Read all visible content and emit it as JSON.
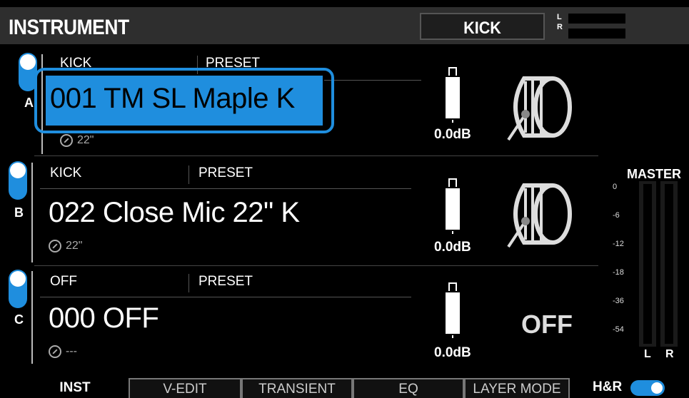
{
  "header": {
    "title": "INSTRUMENT",
    "instrument": "KICK",
    "meter_left_label": "L",
    "meter_right_label": "R"
  },
  "layers": [
    {
      "letter": "A",
      "enabled": true,
      "category": "KICK",
      "preset_label": "PRESET",
      "name": "001 TM SL Maple K",
      "size": "22\"",
      "level": "0.0dB",
      "selected": true
    },
    {
      "letter": "B",
      "enabled": true,
      "category": "KICK",
      "preset_label": "PRESET",
      "name": "022 Close Mic 22\" K",
      "size": "22\"",
      "level": "0.0dB",
      "selected": false
    },
    {
      "letter": "C",
      "enabled": true,
      "category": "OFF",
      "preset_label": "PRESET",
      "name": "000 OFF",
      "size": "---",
      "level": "0.0dB",
      "status": "OFF",
      "selected": false
    }
  ],
  "master": {
    "title": "MASTER",
    "scale": [
      "0",
      "-6",
      "-12",
      "-18",
      "-36",
      "-54"
    ],
    "left_label": "L",
    "right_label": "R"
  },
  "tabs": [
    {
      "label": "INST",
      "active": true
    },
    {
      "label": "V-EDIT",
      "active": false
    },
    {
      "label": "TRANSIENT",
      "active": false
    },
    {
      "label": "EQ",
      "active": false
    },
    {
      "label": "LAYER MODE",
      "active": false
    }
  ],
  "hr": {
    "label": "H&R",
    "enabled": true
  },
  "colors": {
    "accent": "#1f8ede",
    "header_bg": "#2e2e2e",
    "background": "#000000"
  }
}
